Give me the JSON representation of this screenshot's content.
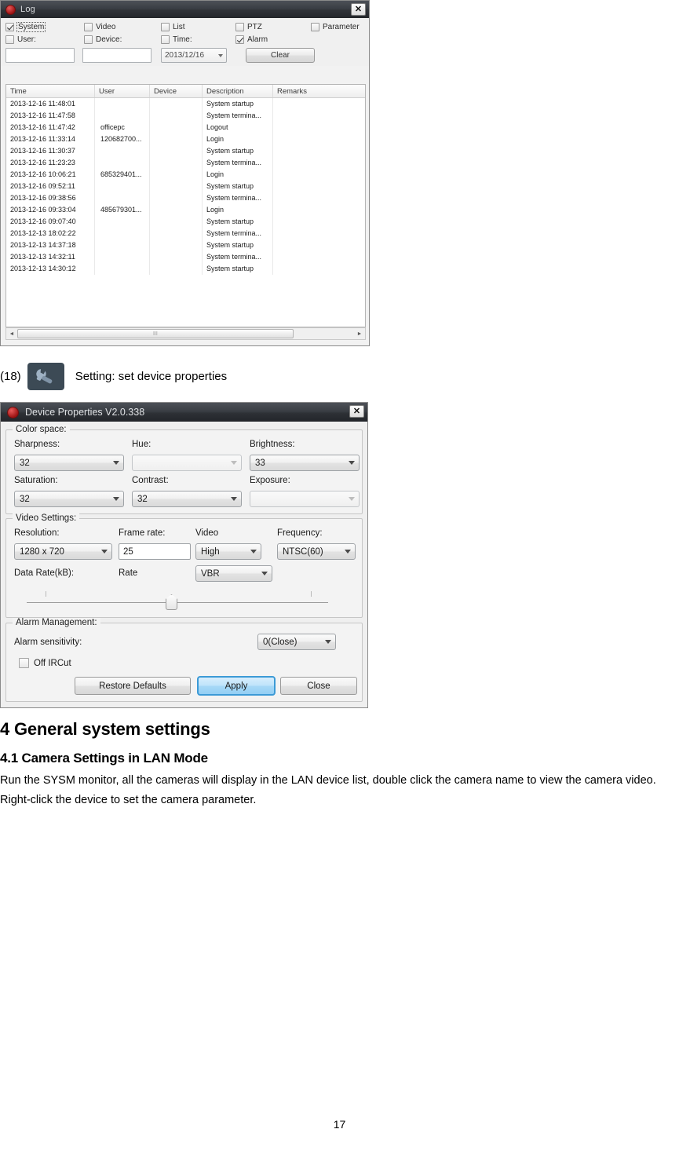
{
  "log_window": {
    "title": "Log",
    "title_icon": "app-circle-icon",
    "close_label": "✕",
    "filters_row1": [
      {
        "label": "System",
        "checked": true,
        "focused": true
      },
      {
        "label": "Video",
        "checked": false,
        "focused": false
      },
      {
        "label": "List",
        "checked": false,
        "focused": false
      },
      {
        "label": "PTZ",
        "checked": false,
        "focused": false
      },
      {
        "label": "Parameter",
        "checked": false,
        "focused": false
      }
    ],
    "filters_row2": [
      {
        "label": "User:",
        "checked": false,
        "focused": false
      },
      {
        "label": "Device:",
        "checked": false,
        "focused": false
      },
      {
        "label": "Time:",
        "checked": false,
        "focused": false
      },
      {
        "label": "Alarm",
        "checked": true,
        "focused": false
      }
    ],
    "user_input_value": "",
    "device_input_value": "",
    "date_value": "2013/12/16",
    "clear_label": "Clear",
    "columns": [
      "Time",
      "User",
      "Device",
      "Description",
      "Remarks"
    ],
    "rows": [
      {
        "time": "2013-12-16 11:48:01",
        "user": "",
        "device": "",
        "description": "System startup",
        "remarks": ""
      },
      {
        "time": "2013-12-16 11:47:58",
        "user": "",
        "device": "",
        "description": "System termina...",
        "remarks": ""
      },
      {
        "time": "2013-12-16 11:47:42",
        "user": "officepc",
        "device": "",
        "description": "Logout",
        "remarks": ""
      },
      {
        "time": "2013-12-16 11:33:14",
        "user": "120682700...",
        "device": "",
        "description": "Login",
        "remarks": ""
      },
      {
        "time": "2013-12-16 11:30:37",
        "user": "",
        "device": "",
        "description": "System startup",
        "remarks": ""
      },
      {
        "time": "2013-12-16 11:23:23",
        "user": "",
        "device": "",
        "description": "System termina...",
        "remarks": ""
      },
      {
        "time": "2013-12-16 10:06:21",
        "user": "685329401...",
        "device": "",
        "description": "Login",
        "remarks": ""
      },
      {
        "time": "2013-12-16 09:52:11",
        "user": "",
        "device": "",
        "description": "System startup",
        "remarks": ""
      },
      {
        "time": "2013-12-16 09:38:56",
        "user": "",
        "device": "",
        "description": "System termina...",
        "remarks": ""
      },
      {
        "time": "2013-12-16 09:33:04",
        "user": "485679301...",
        "device": "",
        "description": "Login",
        "remarks": ""
      },
      {
        "time": "2013-12-16 09:07:40",
        "user": "",
        "device": "",
        "description": "System startup",
        "remarks": ""
      },
      {
        "time": "2013-12-13 18:02:22",
        "user": "",
        "device": "",
        "description": "System termina...",
        "remarks": ""
      },
      {
        "time": "2013-12-13 14:37:18",
        "user": "",
        "device": "",
        "description": "System startup",
        "remarks": ""
      },
      {
        "time": "2013-12-13 14:32:11",
        "user": "",
        "device": "",
        "description": "System termina...",
        "remarks": ""
      },
      {
        "time": "2013-12-13 14:30:12",
        "user": "",
        "device": "",
        "description": "System startup",
        "remarks": ""
      }
    ],
    "scrollbar": {
      "left_arrow": "◄",
      "right_arrow": "►",
      "grip": "III"
    }
  },
  "caption": {
    "number": "(18)",
    "icon": "wrench-icon",
    "text": "Setting: set device properties"
  },
  "device_window": {
    "title": "Device Properties V2.0.338",
    "title_icon": "app-circle-icon",
    "close_label": "✕",
    "color_space": {
      "group_label": "Color space:",
      "sharpness_label": "Sharpness:",
      "sharpness_value": "32",
      "hue_label": "Hue:",
      "hue_value": "",
      "brightness_label": "Brightness:",
      "brightness_value": "33",
      "saturation_label": "Saturation:",
      "saturation_value": "32",
      "contrast_label": "Contrast:",
      "contrast_value": "32",
      "exposure_label": "Exposure:",
      "exposure_value": ""
    },
    "video_settings": {
      "group_label": "Video Settings:",
      "resolution_label": "Resolution:",
      "resolution_value": "1280 x 720",
      "framerate_label": "Frame rate:",
      "framerate_value": "25",
      "video_label": "Video",
      "video_value": "High",
      "frequency_label": "Frequency:",
      "frequency_value": "NTSC(60)",
      "datarate_label": "Data Rate(kB):",
      "rate_label": "Rate",
      "rate_value": "VBR"
    },
    "alarm_management": {
      "group_label": "Alarm Management:",
      "sensitivity_label": "Alarm sensitivity:",
      "sensitivity_value": "0(Close)",
      "ircut_label": "Off IRCut",
      "ircut_checked": false
    },
    "buttons": {
      "restore": "Restore Defaults",
      "apply": "Apply",
      "close": "Close"
    }
  },
  "document": {
    "heading1": "4 General system settings",
    "heading2": "4.1 Camera Settings in LAN Mode",
    "paragraph1": "Run the SYSM monitor, all the cameras will display in the LAN device list, double click the camera name to view the camera video.",
    "paragraph2": "Right-click the device to set the camera parameter.",
    "page_number": "17"
  }
}
